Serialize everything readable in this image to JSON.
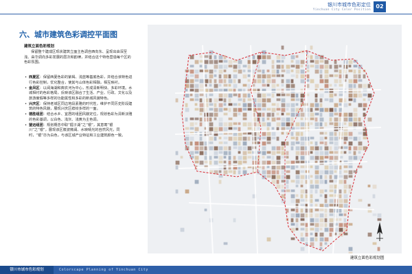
{
  "header": {
    "title": "银川市城市色彩定位",
    "subtitle": "Yinchuan City Color Position",
    "page_number": "02"
  },
  "section_title": "六、城市建筑色彩调控平面图",
  "subheading": "建筑立面色彩规划",
  "intro_paragraph": "保留整个建成区现状建筑立面主色调自西向东、呈现出由深至浅、由华调向多彩发展的层次和韵律，并结合这个特色营造每个区的色彩氛围。",
  "bullets": [
    {
      "term": "西夏区",
      "text": "：保留西夏色彩的紫褐、浅蓝等基底色彩，并结合该特色进行色彩控制，优化整合，使其与山体色彩相融，相互映衬。"
    },
    {
      "term": "金凤区",
      "text": "：以阅海湖和典农河为中心，形成清新明快、多彩环境。水城相衬的色彩格局，反映该区融合了生活、产业、行政、文化以及旅游度假等多样的功能属性和多彩的新城风貌特色。"
    },
    {
      "term": "兴庆区",
      "text": "：保持老城区同边地段素雅的时代性，维护不同历史阶段建筑的特色风貌，展现兴庆区缤纷多样的一面。"
    },
    {
      "term": "德胜组团",
      "text": "：结合水乡、宜居的组团风貌定位，规划色彩为清新淡雅的色彩基调，以白色、浅灰、浅黄为主色调。"
    },
    {
      "term": "望远组团",
      "text": "：规划概念中取“掘子湖”之“银”，其意寄“银川”之“银”，展现该区筱波微澜、水映晴光的自然风光，同时，“银”亦为白色，与该区城产业特征和工业建筑颜色一致。"
    }
  ],
  "map": {
    "caption": "建筑立面色彩规划图",
    "compass_icon": "north-arrow-icon",
    "colors": {
      "background": "#eef0f3",
      "boundary": "#d9363e",
      "road": "#ffffff",
      "palette": [
        "#c9a98a",
        "#8a6b5a",
        "#b9c3cf",
        "#d8c6a8",
        "#e2d6c4",
        "#a8b4c4",
        "#c48e7a",
        "#9ba9bb",
        "#dccdb0",
        "#b5957e",
        "#cfd6df",
        "#7e5e50"
      ]
    }
  },
  "footer": {
    "left_label": "银川市城市色彩规划",
    "right_label": "Colorscape Planning of Yinchuan City"
  }
}
